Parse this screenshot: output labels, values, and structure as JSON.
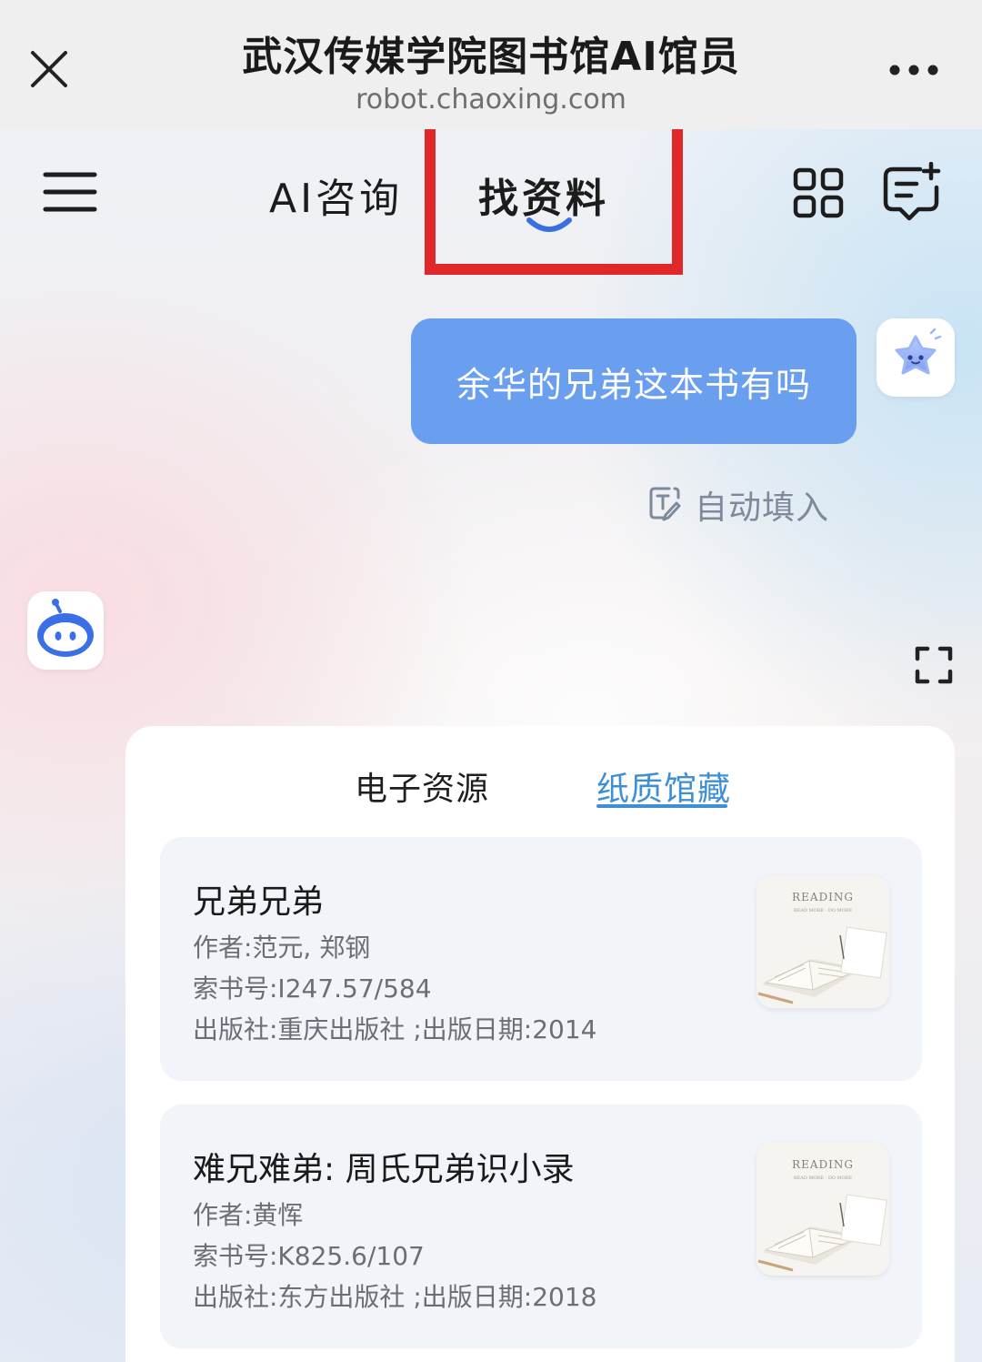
{
  "browser": {
    "title": "武汉传媒学院图书馆AI馆员",
    "url": "robot.chaoxing.com"
  },
  "nav": {
    "tab_ai": "AI咨询",
    "tab_find": "找资料"
  },
  "chat": {
    "user_message": "余华的兄弟这本书有吗",
    "autofill_label": "自动填入"
  },
  "results": {
    "tabs": [
      "电子资源",
      "纸质馆藏"
    ],
    "active_tab": "纸质馆藏",
    "books": [
      {
        "title": "兄弟兄弟",
        "author": "作者:范元, 郑钢",
        "call_number": "索书号:I247.57/584",
        "publisher": "出版社:重庆出版社 ;出版日期:2014",
        "cover_text": "READING",
        "cover_subtext": "READ MORE · DO MORE"
      },
      {
        "title": "难兄难弟: 周氏兄弟识小录",
        "author": "作者:黄恽",
        "call_number": "索书号:K825.6/107",
        "publisher": "出版社:东方出版社 ;出版日期:2018",
        "cover_text": "READING",
        "cover_subtext": "READ MORE · DO MORE"
      }
    ]
  },
  "colors": {
    "accent_blue": "#3f8fd6",
    "bubble_blue": "#6a9eee",
    "highlight_red": "#e0282a"
  },
  "icons": [
    "close-icon",
    "more-icon",
    "menu-icon",
    "grid-icon",
    "new-chat-icon",
    "star-avatar-icon",
    "edit-icon",
    "bot-avatar-icon",
    "expand-icon"
  ]
}
